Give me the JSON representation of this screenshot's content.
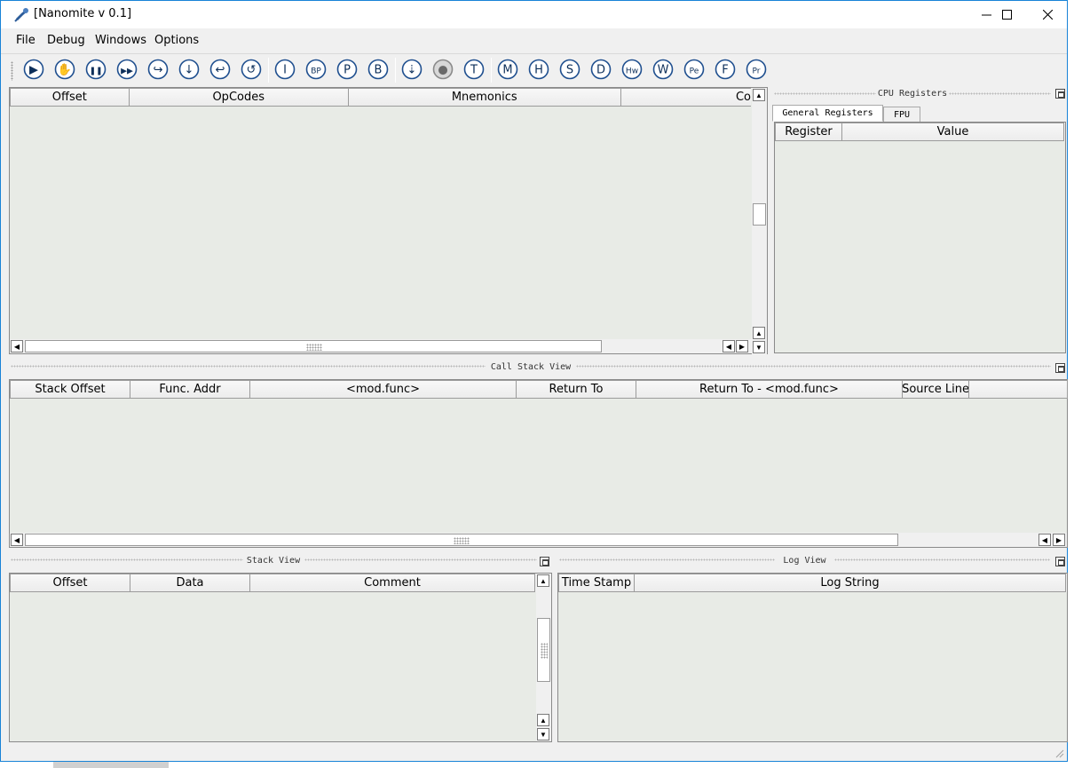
{
  "window": {
    "title": "[Nanomite v 0.1]",
    "controls": {
      "minimize": "—",
      "maximize": "☐",
      "close": "✕"
    }
  },
  "menu": [
    "File",
    "Debug",
    "Windows",
    "Options"
  ],
  "toolbar": {
    "buttons": [
      {
        "name": "run-icon",
        "glyph": "▶"
      },
      {
        "name": "hand-icon",
        "glyph": "✋"
      },
      {
        "name": "pause-icon",
        "glyph": "❚❚"
      },
      {
        "name": "fast-forward-icon",
        "glyph": "▶▶"
      },
      {
        "name": "step-over-icon",
        "glyph": "↪"
      },
      {
        "name": "step-into-icon",
        "glyph": "↓"
      },
      {
        "name": "step-back-icon",
        "glyph": "↩"
      },
      {
        "name": "step-out-icon",
        "glyph": "↺"
      },
      {
        "name": "info-icon",
        "glyph": "I"
      },
      {
        "name": "breakpoint-icon",
        "glyph": "BP"
      },
      {
        "name": "process-icon",
        "glyph": "P"
      },
      {
        "name": "b-icon",
        "glyph": "B"
      },
      {
        "name": "dump-icon",
        "glyph": "⇣"
      },
      {
        "name": "plugin-icon",
        "glyph": "●"
      },
      {
        "name": "threads-icon",
        "glyph": "T"
      },
      {
        "name": "memory-icon",
        "glyph": "M"
      },
      {
        "name": "handles-icon",
        "glyph": "H"
      },
      {
        "name": "strings-icon",
        "glyph": "S"
      },
      {
        "name": "dbgstring-icon",
        "glyph": "D"
      },
      {
        "name": "hw-breakpoint-icon",
        "glyph": "Hw"
      },
      {
        "name": "windows-icon",
        "glyph": "W"
      },
      {
        "name": "pe-icon",
        "glyph": "Pe"
      },
      {
        "name": "functions-icon",
        "glyph": "F"
      },
      {
        "name": "privilege-icon",
        "glyph": "Pr"
      }
    ]
  },
  "disassembly": {
    "columns": [
      "Offset",
      "OpCodes",
      "Mnemonics",
      "Co"
    ]
  },
  "cpu_registers": {
    "title": "CPU Registers",
    "tabs": [
      "General Registers",
      "FPU"
    ],
    "columns": [
      "Register",
      "Value"
    ]
  },
  "call_stack": {
    "title": "Call Stack View",
    "columns": [
      "Stack Offset",
      "Func. Addr",
      "<mod.func>",
      "Return To",
      "Return To - <mod.func>",
      "Source Line"
    ]
  },
  "stack_view": {
    "title": "Stack View",
    "columns": [
      "Offset",
      "Data",
      "Comment"
    ]
  },
  "log_view": {
    "title": "Log View",
    "columns": [
      "Time Stamp",
      "Log String"
    ]
  },
  "colors": {
    "panel_bg": "#e8ebe6",
    "window_border": "#1883d7",
    "icon_stroke": "#1f4f8f"
  }
}
